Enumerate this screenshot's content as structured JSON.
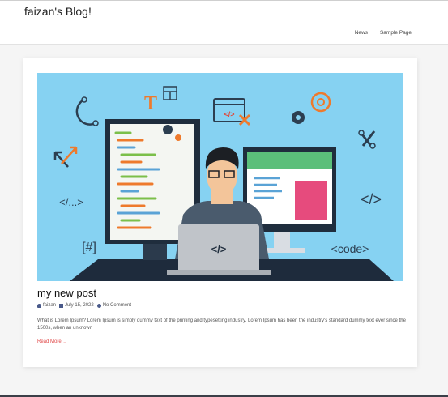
{
  "site": {
    "title": "faizan's Blog!"
  },
  "nav": {
    "items": [
      "News",
      "Sample Page"
    ]
  },
  "post": {
    "title": "my new post",
    "author": "faizan",
    "date": "July 15, 2022",
    "comments": "No Comment",
    "excerpt": "What is Lorem Ipsum? Lorem Ipsum is simply dummy text of the printing and typesetting industry. Lorem Ipsum has been the industry's standard dummy text ever since the 1500s, when an unknown",
    "read_more": "Read More →",
    "image_texts": {
      "code_left": "</...>",
      "code_right": "</>",
      "hash": "[#]",
      "code_tag": "<code>",
      "laptop": "</>",
      "monitor": "</>",
      "t_letter": "T"
    }
  },
  "colors": {
    "hero_bg": "#86d2f2",
    "accent": "#e04848",
    "dark": "#2c3e50",
    "orange": "#ee7a2c"
  }
}
